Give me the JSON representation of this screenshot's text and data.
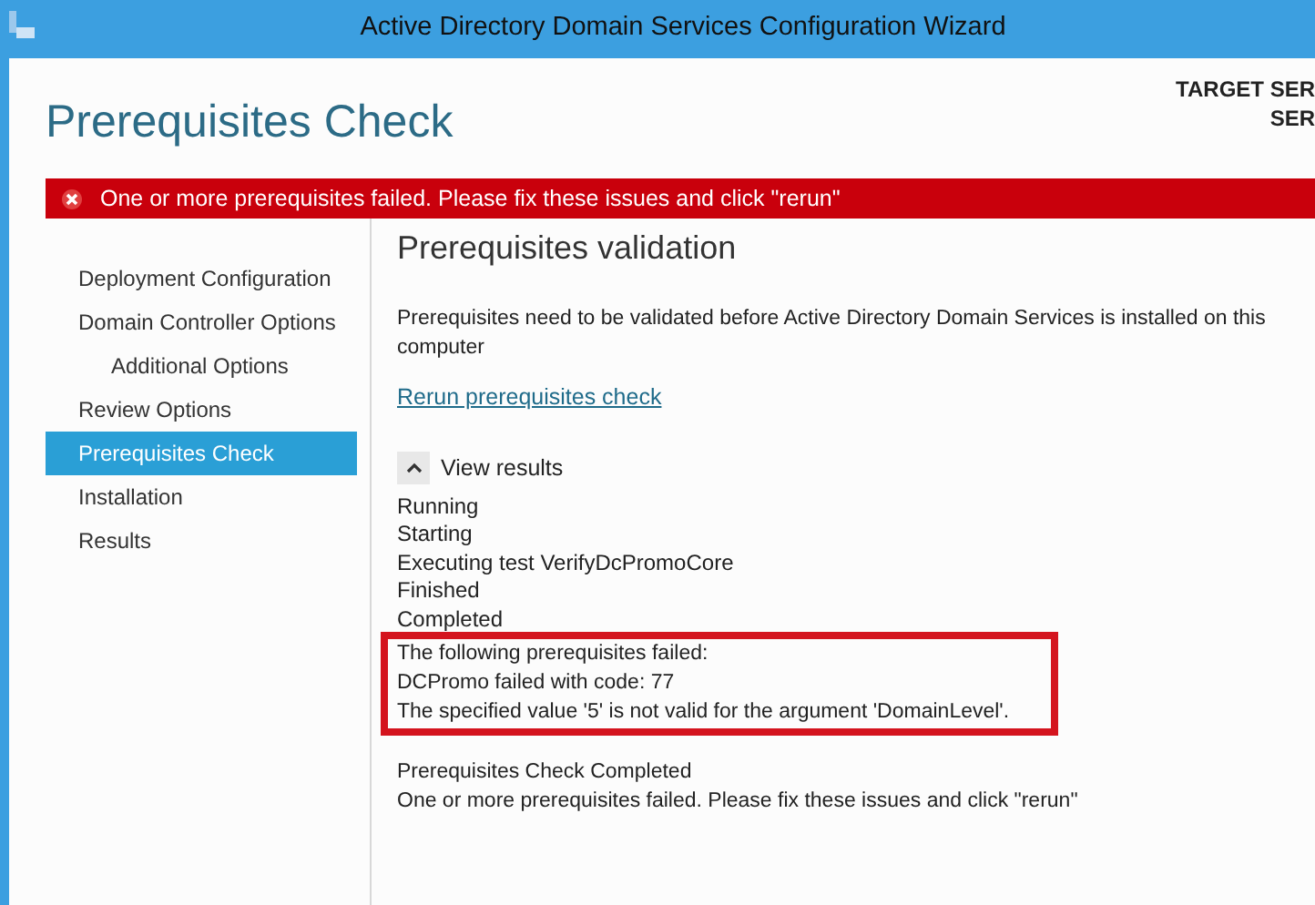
{
  "window": {
    "title": "Active Directory Domain Services Configuration Wizard"
  },
  "page_title": "Prerequisites Check",
  "target_server": [
    "TARGET SER",
    "SER"
  ],
  "error_banner": {
    "message": "One or more prerequisites failed.  Please fix these issues and click \"rerun\""
  },
  "sidebar": {
    "items": [
      {
        "label": "Deployment Configuration",
        "selected": false
      },
      {
        "label": "Domain Controller Options",
        "selected": false,
        "children": [
          {
            "label": "Additional Options",
            "selected": false
          }
        ]
      },
      {
        "label": "Review Options",
        "selected": false
      },
      {
        "label": "Prerequisites Check",
        "selected": true
      },
      {
        "label": "Installation",
        "selected": false
      },
      {
        "label": "Results",
        "selected": false
      }
    ]
  },
  "section_title": "Prerequisites validation",
  "description": "Prerequisites need to be validated before Active Directory Domain Services is installed on this computer",
  "rerun_link": "Rerun prerequisites check",
  "view_results": {
    "label": "View results",
    "expanded": true
  },
  "log_lines": [
    "Running",
    "Starting",
    "Executing test VerifyDcPromoCore",
    "Finished",
    "Completed"
  ],
  "highlighted_lines": [
    "The following prerequisites failed:",
    "DCPromo failed with code: 77",
    "The specified value '5' is not valid for the argument 'DomainLevel'."
  ],
  "summary_lines": [
    "Prerequisites Check Completed",
    "One or more prerequisites failed.  Please fix these issues and click \"rerun\""
  ]
}
